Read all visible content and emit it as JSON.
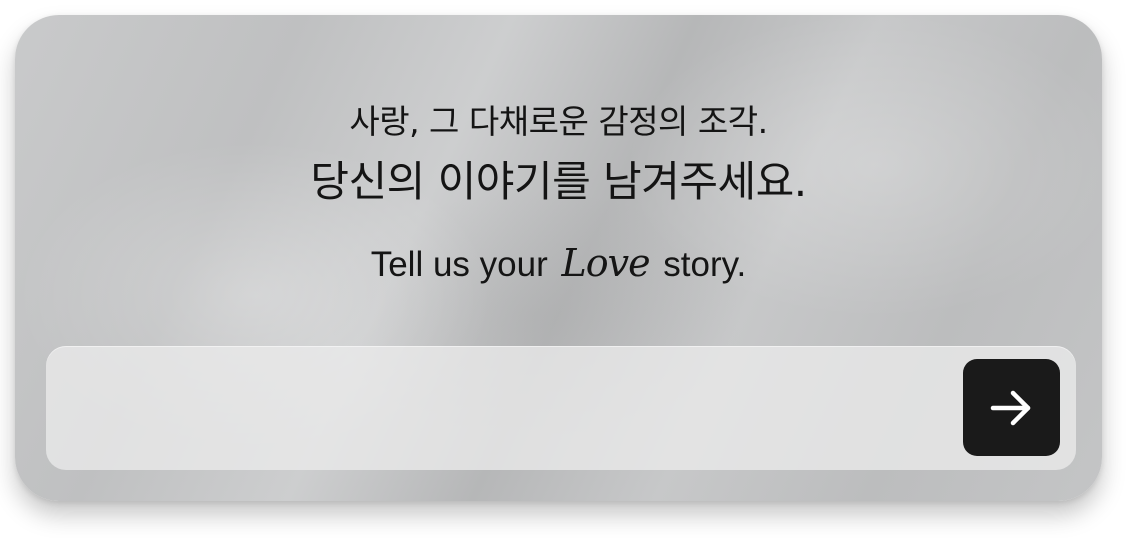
{
  "prompt": {
    "line1": "사랑, 그 다채로운 감정의 조각.",
    "line2": "당신의 이야기를 남겨주세요.",
    "tagline_before": "Tell us your",
    "tagline_script": "Love",
    "tagline_after": "story."
  },
  "input": {
    "value": "",
    "placeholder": ""
  },
  "submit": {
    "icon": "arrow-right-icon"
  },
  "colors": {
    "button_bg": "#1a1a1a",
    "button_icon": "#ffffff",
    "text": "#141414",
    "input_bg": "#e6e6e6"
  }
}
